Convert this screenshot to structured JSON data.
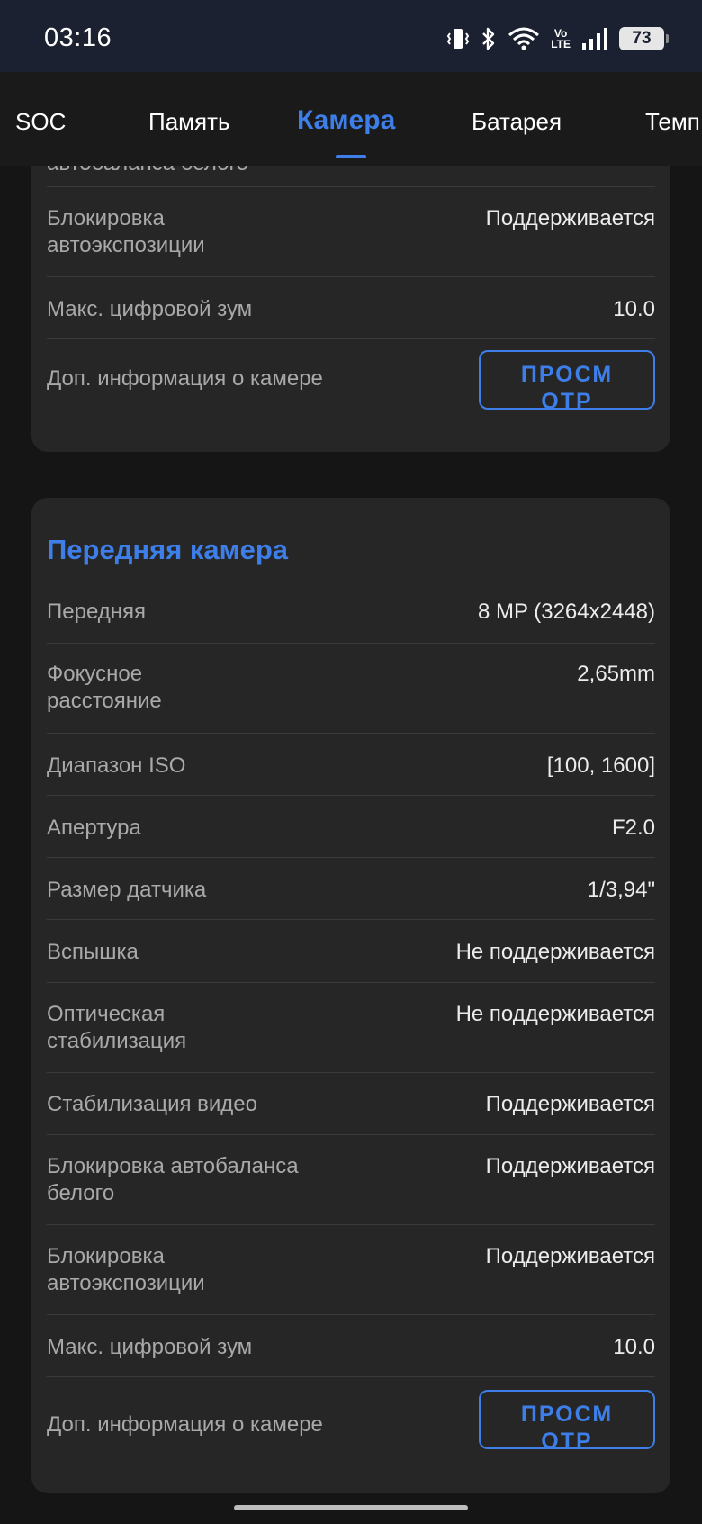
{
  "status_bar": {
    "time": "03:16",
    "volte_top": "Vo",
    "volte_bottom": "LTE",
    "battery": "73",
    "icons": [
      "vibrate-icon",
      "bluetooth-icon",
      "wifi-icon",
      "volte-icon",
      "signal-icon",
      "battery-icon"
    ]
  },
  "tabs": [
    {
      "label": "SOC"
    },
    {
      "label": "Память"
    },
    {
      "label": "Камера",
      "active": true
    },
    {
      "label": "Батарея"
    },
    {
      "label": "Темп"
    }
  ],
  "rear_camera_tail": {
    "rows": [
      {
        "label": "автобаланса белого",
        "value": ""
      },
      {
        "label": "Блокировка автоэкспозиции",
        "value": "Поддерживается"
      },
      {
        "label": "Макс. цифровой зум",
        "value": "10.0"
      },
      {
        "label": "Доп. информация о камере",
        "button": "ПРОСМОТР"
      }
    ]
  },
  "front_camera": {
    "title": "Передняя камера",
    "rows": [
      {
        "label": "Передняя",
        "value": "8 MP (3264x2448)"
      },
      {
        "label": "Фокусное расстояние",
        "value": "2,65mm"
      },
      {
        "label": "Диапазон ISO",
        "value": "[100, 1600]"
      },
      {
        "label": "Апертура",
        "value": "F2.0"
      },
      {
        "label": "Размер датчика",
        "value": "1/3,94\""
      },
      {
        "label": "Вспышка",
        "value": "Не поддерживается"
      },
      {
        "label": "Оптическая стабилизация",
        "value": "Не поддерживается"
      },
      {
        "label": "Стабилизация видео",
        "value": "Поддерживается"
      },
      {
        "label": "Блокировка автобаланса белого",
        "value": "Поддерживается"
      },
      {
        "label": "Блокировка автоэкспозиции",
        "value": "Поддерживается"
      },
      {
        "label": "Макс. цифровой зум",
        "value": "10.0"
      },
      {
        "label": "Доп. информация о камере",
        "button": "ПРОСМОТР"
      }
    ]
  },
  "colors": {
    "accent": "#3d7ee8",
    "status_bar_bg": "#1b2130",
    "card_bg": "#262626",
    "page_bg": "#151515"
  }
}
